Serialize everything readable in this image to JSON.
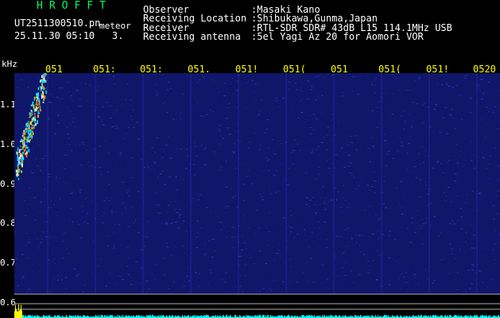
{
  "app": {
    "title": "HROFFT"
  },
  "file": {
    "name": "UT2511300510.pn",
    "tag": "meteor",
    "stamp": "25.11.30 05:10",
    "count": "3."
  },
  "meta": [
    {
      "key": "Observer",
      "value": ":Masaki Kano"
    },
    {
      "key": "Receiving Location",
      "value": ":Shibukawa,Gunma,Japan"
    },
    {
      "key": "Receiver",
      "value": ":RTL-SDR SDR# 43dB L15 114.1MHz USB"
    },
    {
      "key": "Receiving antenna",
      "value": ":5el Yagi Az 20 for Aomori VOR"
    }
  ],
  "axis": {
    "unit": "kHz",
    "yticks": [
      "1.1",
      "1.0",
      "0.9",
      "0.8",
      "0.7",
      "0.6"
    ],
    "xticks": [
      "051",
      "051:",
      "051:",
      "051.",
      "051!",
      "051(",
      "051",
      "051(",
      "051!",
      "0520"
    ]
  },
  "colors": {
    "background": "#000000",
    "noise": "#1a2090",
    "signal": "#00ffff",
    "tick": "#ffff00",
    "title": "#00ff66"
  }
}
